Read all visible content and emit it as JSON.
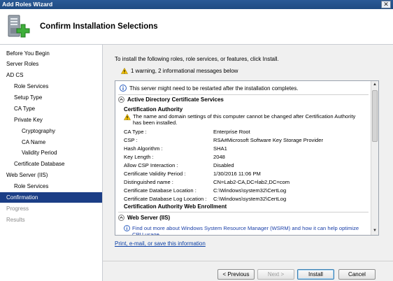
{
  "window": {
    "title": "Add Roles Wizard",
    "close_glyph": "✕"
  },
  "header": {
    "title": "Confirm Installation Selections",
    "icon": "server-add-icon"
  },
  "sidebar": {
    "items": [
      {
        "label": "Before You Begin",
        "state": "normal"
      },
      {
        "label": "Server Roles",
        "state": "normal"
      },
      {
        "label": "AD CS",
        "state": "normal"
      },
      {
        "label": "Role Services",
        "state": "normal"
      },
      {
        "label": "Setup Type",
        "state": "normal"
      },
      {
        "label": "CA Type",
        "state": "normal"
      },
      {
        "label": "Private Key",
        "state": "normal"
      },
      {
        "label": "Cryptography",
        "state": "normal"
      },
      {
        "label": "CA Name",
        "state": "normal"
      },
      {
        "label": "Validity Period",
        "state": "normal"
      },
      {
        "label": "Certificate Database",
        "state": "normal"
      },
      {
        "label": "Web Server (IIS)",
        "state": "normal"
      },
      {
        "label": "Role Services",
        "state": "normal"
      },
      {
        "label": "Confirmation",
        "state": "active"
      },
      {
        "label": "Progress",
        "state": "disabled"
      },
      {
        "label": "Results",
        "state": "disabled"
      }
    ]
  },
  "main": {
    "intro": "To install the following roles, role services, or features, click Install.",
    "summary": "1 warning, 2 informational messages below",
    "restart_note": "This server might need to be restarted after the installation completes.",
    "adcs": {
      "title": "Active Directory Certificate Services",
      "sub_title": "Certification Authority",
      "warning": "The name and domain settings of this computer cannot be changed after Certification Authority has been installed.",
      "rows": [
        {
          "k": "CA Type :",
          "v": "Enterprise Root"
        },
        {
          "k": "CSP :",
          "v": "RSA#Microsoft Software Key Storage Provider"
        },
        {
          "k": "Hash Algorithm :",
          "v": "SHA1"
        },
        {
          "k": "Key Length :",
          "v": "2048"
        },
        {
          "k": "Allow CSP Interaction :",
          "v": "Disabled"
        },
        {
          "k": "Certificate Validity Period :",
          "v": "1/30/2016 11:06 PM"
        },
        {
          "k": "Distinguished name :",
          "v": "CN=Lab2-CA,DC=lab2,DC=com"
        },
        {
          "k": "Certificate Database Location :",
          "v": "C:\\Windows\\system32\\CertLog"
        },
        {
          "k": "Certificate Database Log Location :",
          "v": "C:\\Windows\\system32\\CertLog"
        }
      ],
      "web_enrollment": "Certification Authority Web Enrollment"
    },
    "web_server": {
      "title": "Web Server (IIS)",
      "link": "Find out more about Windows System Resource Manager (WSRM) and how it can help optimize CPU usage"
    },
    "print_link": "Print, e-mail, or save this information"
  },
  "buttons": {
    "previous": "< Previous",
    "next": "Next >",
    "install": "Install",
    "cancel": "Cancel"
  },
  "colors": {
    "active_nav": "#1b3e86",
    "link": "#1a3fa8",
    "titlebar": "#1f4b82"
  }
}
